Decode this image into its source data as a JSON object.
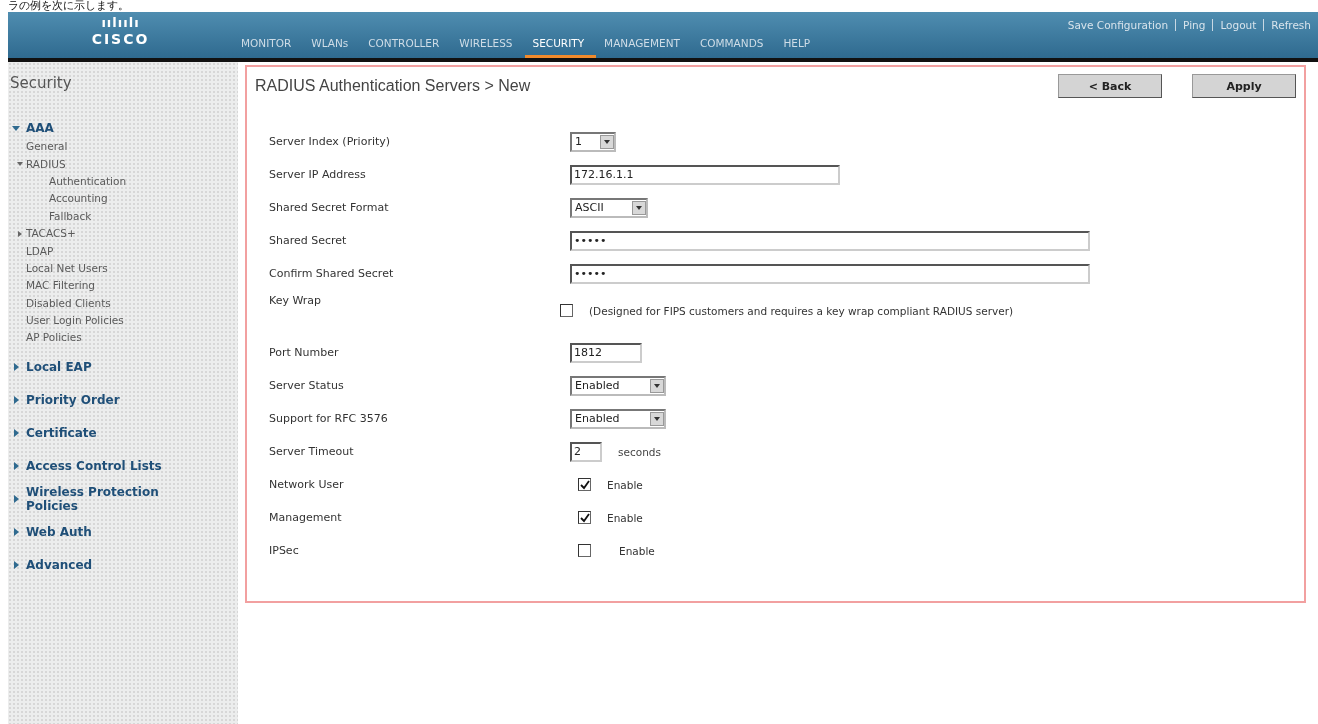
{
  "caption": "ラの例を次に示します。",
  "header": {
    "logo_marks": "ıılıılı",
    "logo": "CISCO",
    "links": [
      "Save Configuration",
      "Ping",
      "Logout",
      "Refresh"
    ],
    "nav": [
      {
        "label": "MONITOR",
        "selected": false
      },
      {
        "label": "WLANs",
        "selected": false
      },
      {
        "label": "CONTROLLER",
        "selected": false
      },
      {
        "label": "WIRELESS",
        "selected": false
      },
      {
        "label": "SECURITY",
        "selected": true
      },
      {
        "label": "MANAGEMENT",
        "selected": false
      },
      {
        "label": "COMMANDS",
        "selected": false
      },
      {
        "label": "HELP",
        "selected": false
      }
    ]
  },
  "sidebar": {
    "title": "Security",
    "items": [
      {
        "label": "AAA",
        "expanded": true,
        "children": [
          {
            "label": "General"
          },
          {
            "label": "RADIUS",
            "expanded": true,
            "children": [
              {
                "label": "Authentication"
              },
              {
                "label": "Accounting"
              },
              {
                "label": "Fallback"
              }
            ]
          },
          {
            "label": "TACACS+",
            "expanded": false
          },
          {
            "label": "LDAP"
          },
          {
            "label": "Local Net Users"
          },
          {
            "label": "MAC Filtering"
          },
          {
            "label": "Disabled Clients"
          },
          {
            "label": "User Login Policies"
          },
          {
            "label": "AP Policies"
          }
        ]
      },
      {
        "label": "Local EAP",
        "expanded": false
      },
      {
        "label": "Priority Order",
        "expanded": false
      },
      {
        "label": "Certificate",
        "expanded": false
      },
      {
        "label": "Access Control Lists",
        "expanded": false
      },
      {
        "label": "Wireless Protection Policies",
        "expanded": false
      },
      {
        "label": "Web Auth",
        "expanded": false
      },
      {
        "label": "Advanced",
        "expanded": false
      }
    ]
  },
  "panel": {
    "title": "RADIUS Authentication Servers > New",
    "buttons": [
      "< Back",
      "Apply"
    ],
    "fields": [
      {
        "kind": "select",
        "label": "Server Index (Priority)",
        "value": "1"
      },
      {
        "kind": "text",
        "label": "Server IP Address",
        "value": "172.16.1.1"
      },
      {
        "kind": "select",
        "label": "Shared Secret Format",
        "value": "ASCII"
      },
      {
        "kind": "text",
        "label": "Shared Secret",
        "value": "•••••"
      },
      {
        "kind": "text",
        "label": "Confirm Shared Secret",
        "value": "•••••"
      },
      {
        "kind": "checkbox",
        "label": "Key Wrap",
        "checked": false,
        "text": "(Designed for FIPS customers and requires a key wrap compliant RADIUS server)"
      },
      {
        "kind": "text",
        "label": "Port Number",
        "value": "1812"
      },
      {
        "kind": "select",
        "label": "Server Status",
        "value": "Enabled"
      },
      {
        "kind": "select",
        "label": "Support for RFC 3576",
        "value": "Enabled"
      },
      {
        "kind": "text",
        "label": "Server Timeout",
        "value": "2",
        "suffix": "seconds"
      },
      {
        "kind": "checkbox",
        "label": "Network User",
        "checked": true,
        "text": "Enable"
      },
      {
        "kind": "checkbox",
        "label": "Management",
        "checked": true,
        "text": "Enable"
      },
      {
        "kind": "checkbox",
        "label": "IPSec",
        "checked": false,
        "text": "Enable"
      }
    ]
  }
}
